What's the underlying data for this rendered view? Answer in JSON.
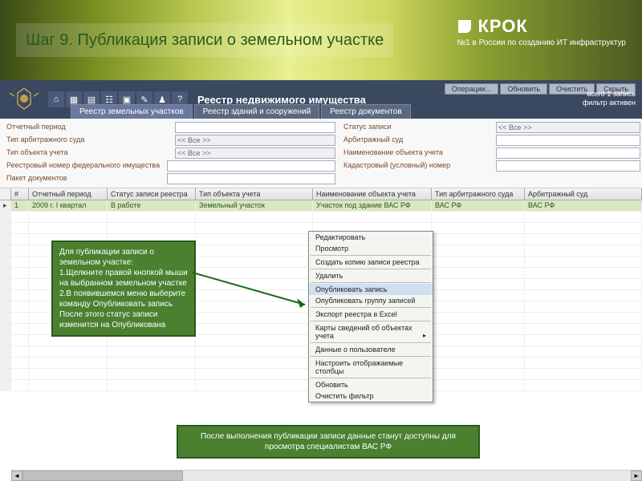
{
  "slide": {
    "title": "Шаг 9. Публикация записи о земельном участке"
  },
  "brand": {
    "name": "КРОК",
    "tagline": "№1 в России по созданию ИТ инфраструктур"
  },
  "app": {
    "title": "Реестр недвижимого имущества",
    "top_buttons": [
      "Операции...",
      "Обновить",
      "Очистить",
      "Скрыть"
    ],
    "status_count": "всего 1 запись",
    "status_filter": "фильтр активен"
  },
  "tabs": [
    {
      "label": "Реестр земельных участков",
      "active": true
    },
    {
      "label": "Реестр зданий и сооружений",
      "active": false
    },
    {
      "label": "Реестр документов",
      "active": false
    }
  ],
  "filters": {
    "left": [
      {
        "label": "Отчетный период",
        "value": "",
        "type": "text"
      },
      {
        "label": "Тип арбитражного суда",
        "value": "<< Все >>",
        "type": "select"
      },
      {
        "label": "Тип объекта учета",
        "value": "<< Все >>",
        "type": "select"
      },
      {
        "label": "Реестровый номер федерального имущества",
        "value": "",
        "type": "text",
        "wide": true
      },
      {
        "label": "Пакет документов",
        "value": "",
        "type": "text",
        "wide": true
      }
    ],
    "right": [
      {
        "label": "Статус записи",
        "value": "<< Все >>",
        "type": "select"
      },
      {
        "label": "Арбитражный суд",
        "value": "",
        "type": "text"
      },
      {
        "label": "Наименование объекта учета",
        "value": "",
        "type": "text"
      },
      {
        "label": "Кадастровый (условный) номер",
        "value": "",
        "type": "text"
      }
    ]
  },
  "grid": {
    "columns": [
      "",
      "#",
      "Отчетный период",
      "Статус записи реестра",
      "Тип объекта учета",
      "Наименование объекта учета",
      "Тип арбитражного суда",
      "Арбитражный суд"
    ],
    "rows": [
      {
        "num": "1",
        "period": "2009 г. I квартал",
        "status": "В работе",
        "type": "Земельный участок",
        "name": "Участок под здание ВАС РФ",
        "court_type": "ВАС РФ",
        "court": "ВАС РФ",
        "selected": true
      }
    ],
    "empty_rows": 16
  },
  "context_menu": {
    "items": [
      {
        "label": "Редактировать"
      },
      {
        "label": "Просмотр"
      },
      {
        "sep": true
      },
      {
        "label": "Создать копию записи реестра"
      },
      {
        "sep": true
      },
      {
        "label": "Удалить"
      },
      {
        "sep": true
      },
      {
        "label": "Опубликовать запись",
        "highlight": true
      },
      {
        "label": "Опубликовать группу записей"
      },
      {
        "sep": true
      },
      {
        "label": "Экспорт реестра в Excel"
      },
      {
        "sep": true
      },
      {
        "label": "Карты сведений об объектах учета",
        "submenu": true
      },
      {
        "sep": true
      },
      {
        "label": "Данные о пользователе"
      },
      {
        "sep": true
      },
      {
        "label": "Настроить отображаемые столбцы"
      },
      {
        "sep": true
      },
      {
        "label": "Обновить"
      },
      {
        "label": "Очистить фильтр"
      }
    ]
  },
  "callouts": {
    "left": "Для публикации записи о земельном участке:\n1.Щелкните правой кнопкой мыши на выбранном земельном участке\n2.В появившемся меню выберите команду Опубликовать запись\nПосле этого статус записи изменится на Опубликована",
    "bottom": "После выполнения публикации записи данные станут доступны для просмотра специалистам ВАС РФ"
  }
}
